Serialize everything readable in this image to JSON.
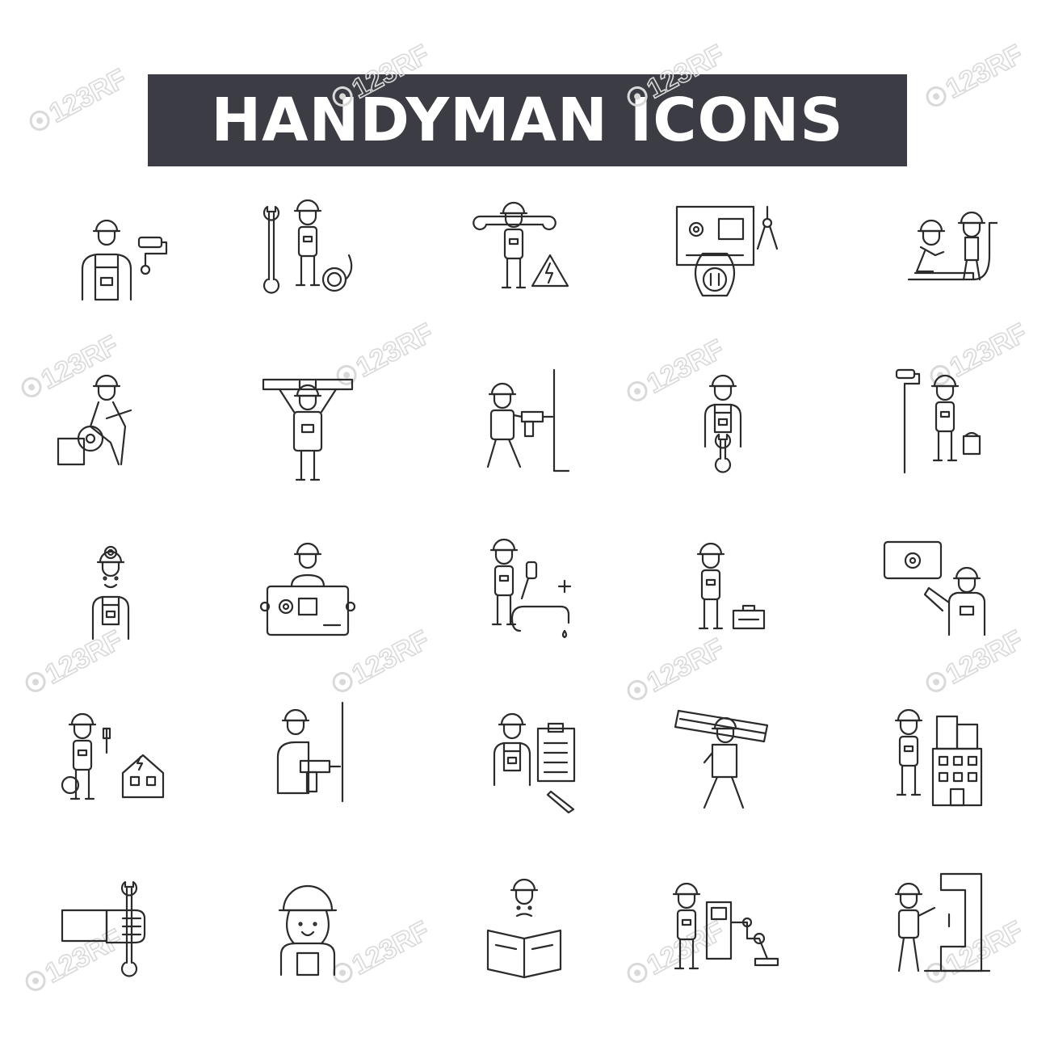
{
  "banner": {
    "title": "HANDYMAN ICONS"
  },
  "colors": {
    "banner_background": "#3c3c44",
    "banner_text": "#ffffff",
    "line_art": "#2b2b2b",
    "watermark": "#d9d9d9"
  },
  "watermark": {
    "logo": "123RF"
  },
  "icons": [
    "worker-with-paint-roller-icon",
    "worker-with-wrench-and-cable-icon",
    "electrician-with-wrench-and-warning-sign-icon",
    "engineer-with-blueprint-and-compass-icon",
    "plumbers-installing-pipe-icon",
    "worker-with-circular-saw-icon",
    "worker-with-level-icon",
    "worker-drilling-wall-icon",
    "worker-holding-wrench-icon",
    "painter-with-roller-and-bucket-icon",
    "miner-with-headlamp-icon",
    "worker-with-blueprint-board-icon",
    "plumber-with-faucet-and-pipe-icon",
    "worker-with-toolbox-icon",
    "worker-presenting-gear-plan-icon",
    "electrician-with-screwdriver-and-house-icon",
    "worker-with-power-drill-icon",
    "worker-with-clipboard-checklist-icon",
    "worker-carrying-planks-icon",
    "architect-with-building-icon",
    "hand-holding-wrench-icon",
    "female-worker-with-helmet-icon",
    "worker-reading-manual-icon",
    "operator-with-robotic-arm-icon",
    "machinist-with-drill-press-icon"
  ]
}
